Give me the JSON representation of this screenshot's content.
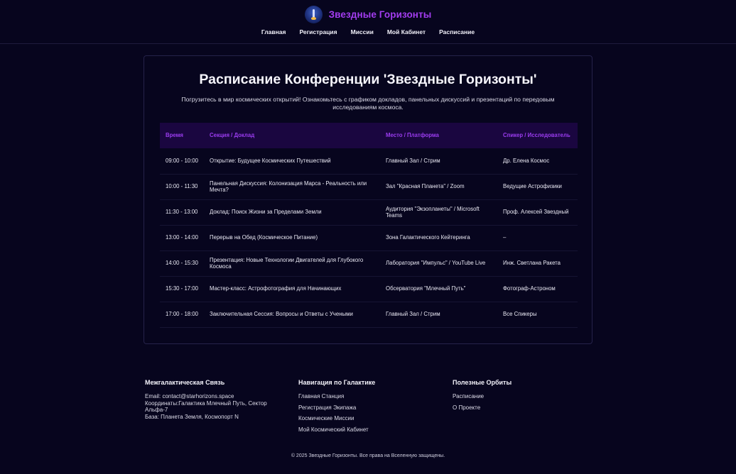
{
  "header": {
    "brand": "Звездные Горизонты",
    "nav": [
      "Главная",
      "Регистрация",
      "Миссии",
      "Мой Кабинет",
      "Расписание"
    ]
  },
  "main": {
    "title": "Расписание Конференции 'Звездные Горизонты'",
    "intro": "Погрузитесь в мир космических открытий! Ознакомьтесь с графиком докладов, панельных дискуссий и презентаций по передовым исследованиям космоса.",
    "table": {
      "headers": [
        "Время",
        "Секция / Доклад",
        "Место / Платформа",
        "Спикер / Исследователь"
      ],
      "rows": [
        [
          "09:00 - 10:00",
          "Открытие: Будущее Космических Путешествий",
          "Главный Зал / Стрим",
          "Др. Елена Космос"
        ],
        [
          "10:00 - 11:30",
          "Панельная Дискуссия: Колонизация Марса - Реальность или Мечта?",
          "Зал \"Красная Планета\" / Zoom",
          "Ведущие Астрофизики"
        ],
        [
          "11:30 - 13:00",
          "Доклад: Поиск Жизни за Пределами Земли",
          "Аудитория \"Экзопланеты\" / Microsoft Teams",
          "Проф. Алексей Звездный"
        ],
        [
          "13:00 - 14:00",
          "Перерыв на Обед (Космическое Питание)",
          "Зона Галактического Кейтеринга",
          "–"
        ],
        [
          "14:00 - 15:30",
          "Презентация: Новые Технологии Двигателей для Глубокого Космоса",
          "Лаборатория \"Импульс\" / YouTube Live",
          "Инж. Светлана Ракета"
        ],
        [
          "15:30 - 17:00",
          "Мастер-класс: Астрофотография для Начинающих",
          "Обсерватория \"Млечный Путь\"",
          "Фотограф-Астроном"
        ],
        [
          "17:00 - 18:00",
          "Заключительная Сессия: Вопросы и Ответы с Учеными",
          "Главный Зал / Стрим",
          "Все Спикеры"
        ]
      ]
    }
  },
  "footer": {
    "contact": {
      "title": "Межгалактическая Связь",
      "email": "Email: contact@starhorizons.space",
      "coords": "Координаты:Галактика Млечный Путь, Сектор Альфа-7",
      "base": "База: Планета Земля, Космопорт N"
    },
    "navigation": {
      "title": "Навигация по Галактике",
      "links": [
        "Главная Станция",
        "Регистрация Экипажа",
        "Космические Миссии",
        "Мой Космический Кабинет"
      ]
    },
    "useful": {
      "title": "Полезные Орбиты",
      "links": [
        "Расписание",
        "О Проекте"
      ]
    },
    "copyright": "© 2025 Звездные Горизонты. Все права на Вселенную защищены."
  },
  "colors": {
    "background": "#07051e",
    "accent": "#9b3cf0",
    "table_header_bg": "#1a0640"
  }
}
